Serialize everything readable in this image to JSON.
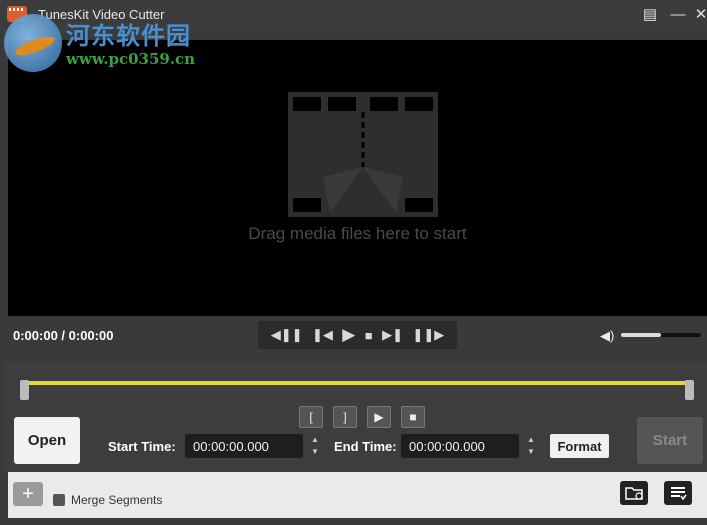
{
  "window": {
    "title": "TunesKit Video Cutter",
    "menu_icon": "menu-icon",
    "minimize_icon": "minimize-icon",
    "close_icon": "close-icon"
  },
  "watermark": {
    "brand": "河东软件园",
    "url": "www.pc0359.cn"
  },
  "preview": {
    "hint": "Drag media files here to start"
  },
  "playback": {
    "time_display": "0:00:00 / 0:00:00",
    "controls": [
      "previous-frame-icon",
      "step-back-icon",
      "play-icon",
      "stop-icon",
      "step-forward-icon",
      "next-frame-icon"
    ],
    "volume_level": 0.5
  },
  "editor": {
    "open_label": "Open",
    "start_time_label": "Start Time:",
    "start_time_value": "00:00:00.000",
    "end_time_label": "End Time:",
    "end_time_value": "00:00:00.000",
    "format_label": "Format",
    "start_label": "Start",
    "segment_buttons": [
      "set-start-icon",
      "set-end-icon",
      "play-segment-icon",
      "stop-segment-icon"
    ]
  },
  "bottom": {
    "add_icon": "plus-icon",
    "merge_label": "Merge Segments",
    "open_folder_icon": "output-folder-icon",
    "list_icon": "task-list-icon"
  },
  "colors": {
    "background": "#3a3a3a",
    "preview": "#000000",
    "range": "#e8d73a",
    "bottom_bar": "#eaeaea"
  }
}
